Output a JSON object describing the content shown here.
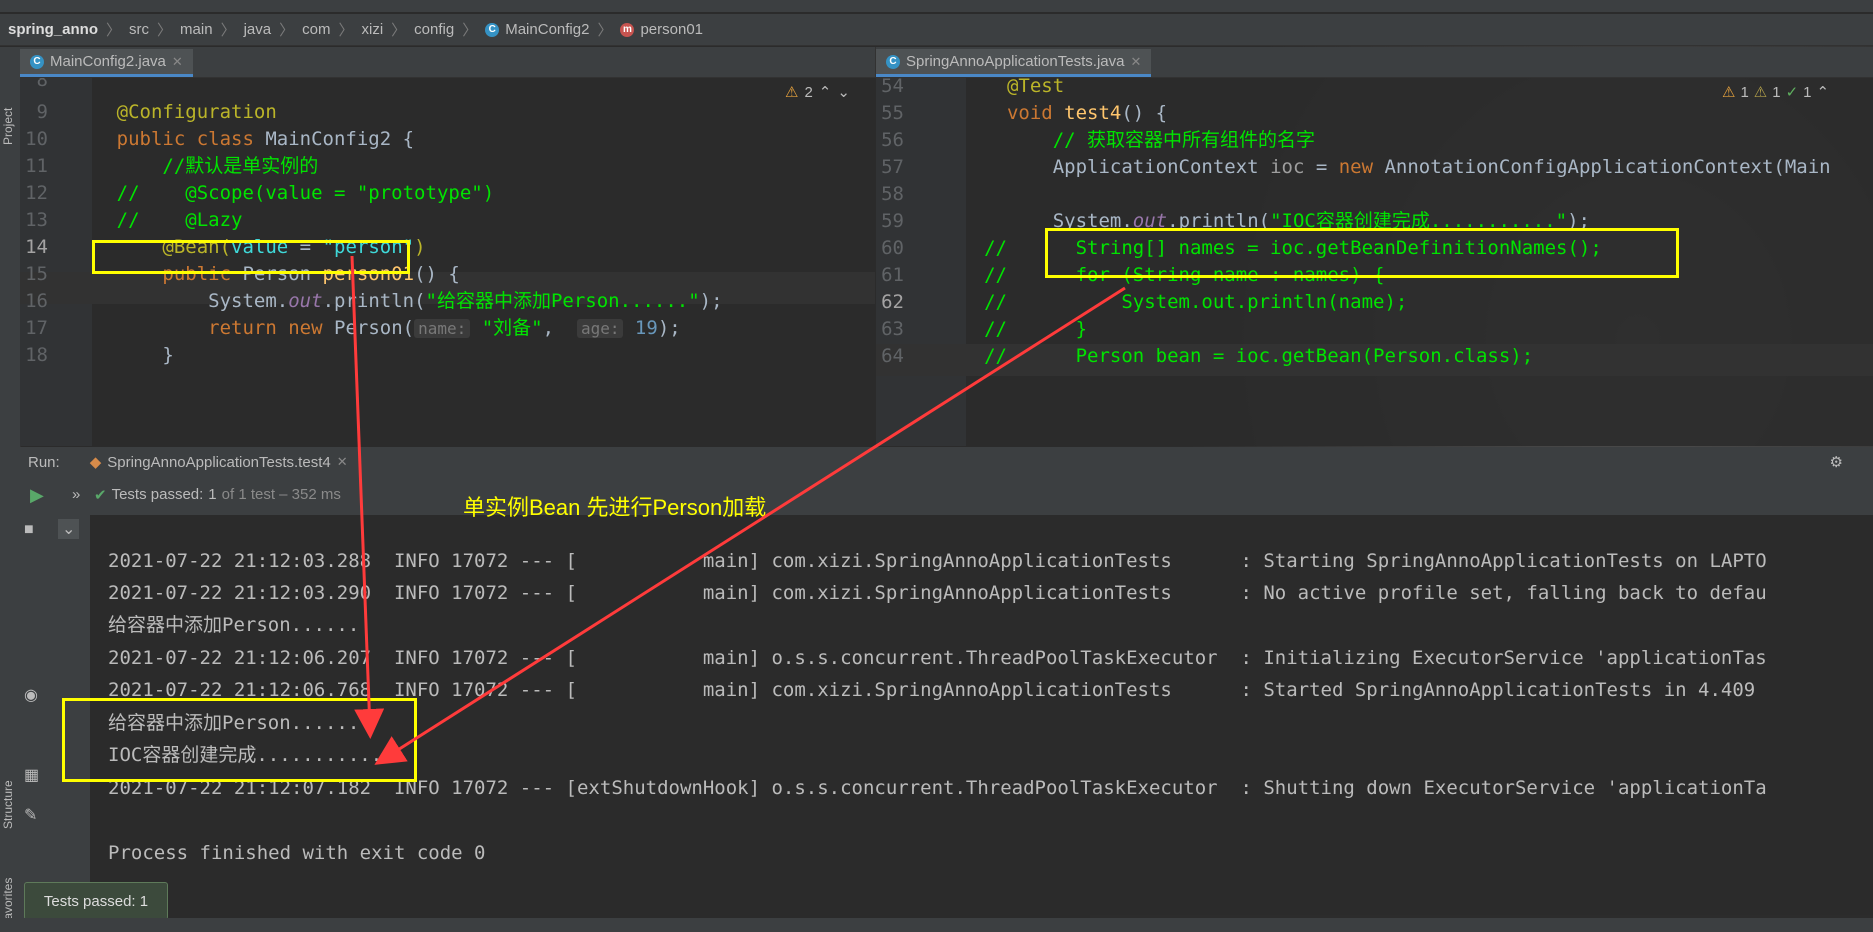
{
  "breadcrumb": {
    "project": "spring_anno",
    "parts": [
      "src",
      "main",
      "java",
      "com",
      "xizi",
      "config"
    ],
    "class_name": "MainConfig2",
    "method_name": "person01"
  },
  "left_strip": {
    "project_label": "Project",
    "structure_label": "Structure",
    "favorites_label": "Favorites"
  },
  "left_editor": {
    "tab_label": "MainConfig2.java",
    "tab_close": "✕",
    "warning_count": "2",
    "lines": [
      {
        "n": "8"
      },
      {
        "n": "9"
      },
      {
        "n": "10"
      },
      {
        "n": "11"
      },
      {
        "n": "12"
      },
      {
        "n": "13"
      },
      {
        "n": "14"
      },
      {
        "n": "15"
      },
      {
        "n": "16"
      },
      {
        "n": "17"
      },
      {
        "n": "18"
      }
    ],
    "code": {
      "l9_annotation": "@Configuration",
      "l10_kw": "public class ",
      "l10_name": "MainConfig2 {",
      "l11": "//默认是单实例的",
      "l12_prefix": "//    ",
      "l12_rest": "@Scope(value = \"prototype\")",
      "l13_prefix": "//    ",
      "l13_rest": "@Lazy",
      "l14_anno": "@Bean(",
      "l14_attr": "value",
      "l14_eq": " = ",
      "l14_str": "\"person\"",
      "l14_close": ")",
      "l15_kw": "public ",
      "l15_type": "Person ",
      "l15_fn": "person01",
      "l15_rest": "() {",
      "l16_sys": "System.",
      "l16_out": "out",
      "l16_call": ".println(",
      "l16_str": "\"给容器中添加Person......\"",
      "l16_end": ");",
      "l17_kw": "return new ",
      "l17_type": "Person(",
      "l17_hint1": "name:",
      "l17_str": "\"刘备\"",
      "l17_comma": ",",
      "l17_hint2": "age:",
      "l17_num": "19",
      "l17_end": ");",
      "l18": "}"
    }
  },
  "right_editor": {
    "tab_label": "SpringAnnoApplicationTests.java",
    "tab_close": "✕",
    "warnings": "1",
    "weak_warnings": "1",
    "checks": "1",
    "lines": [
      {
        "n": "54"
      },
      {
        "n": "55"
      },
      {
        "n": "56"
      },
      {
        "n": "57"
      },
      {
        "n": "58"
      },
      {
        "n": "59"
      },
      {
        "n": "60"
      },
      {
        "n": "61"
      },
      {
        "n": "62"
      },
      {
        "n": "63"
      },
      {
        "n": "64"
      }
    ],
    "code": {
      "l54": "@Test",
      "l55_kw": "void ",
      "l55_fn": "test4",
      "l55_rest": "() {",
      "l56": "// 获取容器中所有组件的名字",
      "l57_type": "ApplicationContext ",
      "l57_var": "ioc",
      "l57_eq": " = ",
      "l57_kw": "new ",
      "l57_rest": "AnnotationConfigApplicationContext(Main",
      "l59_sys": "System.",
      "l59_out": "out",
      "l59_call": ".println(",
      "l59_str": "\"IOC容器创建完成...........\"",
      "l59_end": ");",
      "l60": "//      String[] names = ioc.getBeanDefinitionNames();",
      "l61": "//      for (String name : names) {",
      "l62": "//          System.out.println(name);",
      "l63": "//      }",
      "l64": "//      Person bean = ioc.getBean(Person.class);"
    }
  },
  "run_panel": {
    "run_label": "Run:",
    "run_tab": "SpringAnnoApplicationTests.test4",
    "tests_passed": "Tests passed:",
    "tests_passed_count": "1",
    "tests_detail": "of 1 test – 352 ms",
    "annotation": "单实例Bean 先进行Person加载"
  },
  "console": {
    "lines": [
      "2021-07-22 21:12:03.288  INFO 17072 --- [           main] com.xizi.SpringAnnoApplicationTests      : Starting SpringAnnoApplicationTests on LAPTO",
      "2021-07-22 21:12:03.290  INFO 17072 --- [           main] com.xizi.SpringAnnoApplicationTests      : No active profile set, falling back to defau",
      "给容器中添加Person......",
      "2021-07-22 21:12:06.207  INFO 17072 --- [           main] o.s.s.concurrent.ThreadPoolTaskExecutor  : Initializing ExecutorService 'applicationTas",
      "2021-07-22 21:12:06.768  INFO 17072 --- [           main] com.xizi.SpringAnnoApplicationTests      : Started SpringAnnoApplicationTests in 4.409",
      "给容器中添加Person......",
      "IOC容器创建完成...........",
      "2021-07-22 21:12:07.182  INFO 17072 --- [extShutdownHook] o.s.s.concurrent.ThreadPoolTaskExecutor  : Shutting down ExecutorService 'applicationTa",
      "",
      "Process finished with exit code 0"
    ]
  },
  "toast": {
    "label": "Tests passed: 1"
  },
  "colors": {
    "highlight_box": "#ffff00",
    "arrow": "#ff3b3b",
    "annotation_text": "#ffff00"
  }
}
